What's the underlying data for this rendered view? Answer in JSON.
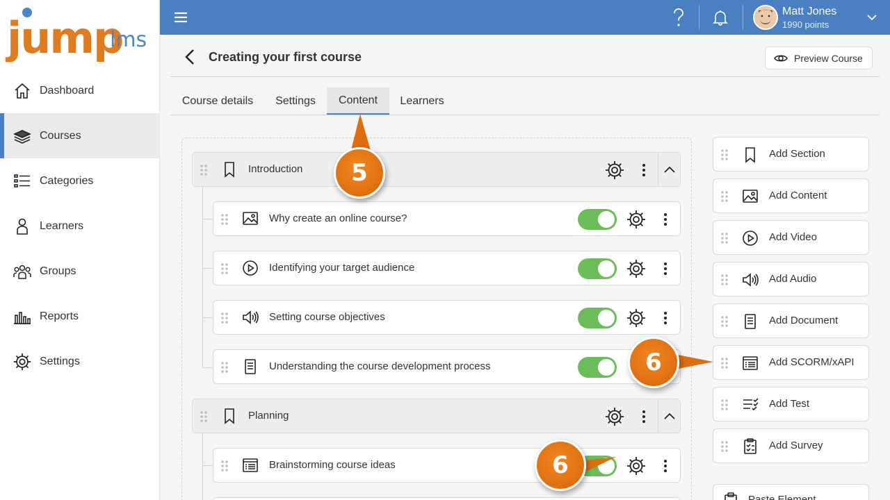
{
  "brand": {
    "logo_text": "jump",
    "logo_suffix": "lms",
    "accent": "#4a7fc1",
    "logo_color": "#e07b1f"
  },
  "sidebar": {
    "items": [
      {
        "label": "Dashboard",
        "icon": "home-icon",
        "active": false
      },
      {
        "label": "Courses",
        "icon": "books-icon",
        "active": true
      },
      {
        "label": "Categories",
        "icon": "list-icon",
        "active": false
      },
      {
        "label": "Learners",
        "icon": "person-icon",
        "active": false
      },
      {
        "label": "Groups",
        "icon": "group-icon",
        "active": false
      },
      {
        "label": "Reports",
        "icon": "bar-chart-icon",
        "active": false
      },
      {
        "label": "Settings",
        "icon": "gear-icon",
        "active": false
      }
    ]
  },
  "topbar": {
    "user_name": "Matt Jones",
    "user_points": "1990 points"
  },
  "header": {
    "title": "Creating your first course",
    "preview_label": "Preview Course"
  },
  "tabs": [
    {
      "label": "Course details",
      "active": false
    },
    {
      "label": "Settings",
      "active": false
    },
    {
      "label": "Content",
      "active": true
    },
    {
      "label": "Learners",
      "active": false
    }
  ],
  "content": {
    "sections": [
      {
        "label": "Introduction",
        "icon": "bookmark-icon",
        "items": [
          {
            "label": "Why create an online course?",
            "icon": "image-icon",
            "enabled": true
          },
          {
            "label": "Identifying your target audience",
            "icon": "play-icon",
            "enabled": true
          },
          {
            "label": "Setting course objectives",
            "icon": "speaker-icon",
            "enabled": true
          },
          {
            "label": "Understanding the course development process",
            "icon": "document-icon",
            "enabled": true
          }
        ]
      },
      {
        "label": "Planning",
        "icon": "bookmark-icon",
        "items": [
          {
            "label": "Brainstorming course ideas",
            "icon": "scorm-icon",
            "enabled": true
          }
        ]
      }
    ]
  },
  "add_buttons": [
    {
      "label": "Add Section",
      "icon": "bookmark-icon"
    },
    {
      "label": "Add Content",
      "icon": "image-icon"
    },
    {
      "label": "Add Video",
      "icon": "play-icon"
    },
    {
      "label": "Add Audio",
      "icon": "speaker-icon"
    },
    {
      "label": "Add Document",
      "icon": "document-icon"
    },
    {
      "label": "Add SCORM/xAPI",
      "icon": "scorm-icon"
    },
    {
      "label": "Add Test",
      "icon": "checklist-icon"
    },
    {
      "label": "Add Survey",
      "icon": "clipboard-icon"
    },
    {
      "label": "Paste Element",
      "icon": "paste-icon"
    }
  ],
  "callouts": [
    {
      "number": "5",
      "color": "#e07b1f"
    },
    {
      "number": "6",
      "color": "#e07b1f"
    },
    {
      "number": "6",
      "color": "#e07b1f"
    }
  ]
}
